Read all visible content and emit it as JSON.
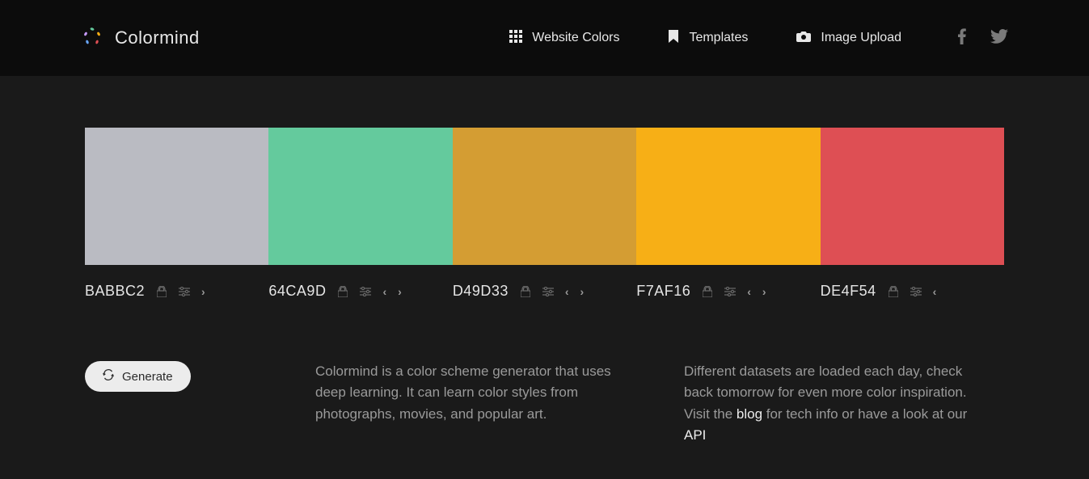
{
  "brand": {
    "name": "Colormind"
  },
  "nav": {
    "website_colors": "Website Colors",
    "templates": "Templates",
    "image_upload": "Image Upload"
  },
  "palette": [
    {
      "hex": "BABBC2",
      "color": "#BABBC2",
      "has_prev": false,
      "has_next": true
    },
    {
      "hex": "64CA9D",
      "color": "#64CA9D",
      "has_prev": true,
      "has_next": true
    },
    {
      "hex": "D49D33",
      "color": "#D49D33",
      "has_prev": true,
      "has_next": true
    },
    {
      "hex": "F7AF16",
      "color": "#F7AF16",
      "has_prev": true,
      "has_next": true
    },
    {
      "hex": "DE4F54",
      "color": "#DE4F54",
      "has_prev": true,
      "has_next": false
    }
  ],
  "generate_label": "Generate",
  "description_left": "Colormind is a color scheme generator that uses deep learning. It can learn color styles from photographs, movies, and popular art.",
  "description_right_pre": "Different datasets are loaded each day, check back tomorrow for even more color inspiration. Visit the ",
  "description_right_link1": "blog",
  "description_right_mid": " for tech info or have a look at our ",
  "description_right_link2": "API"
}
